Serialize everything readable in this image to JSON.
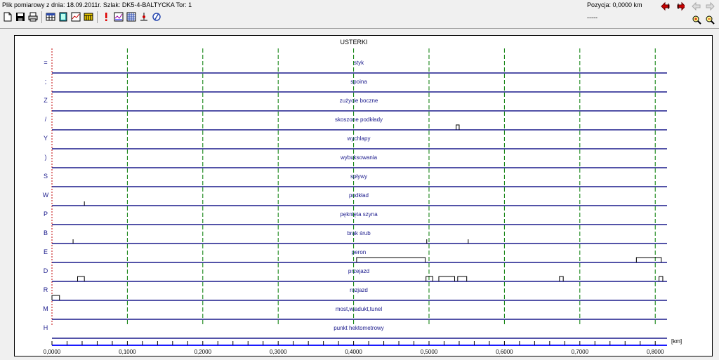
{
  "title_bar": {
    "text": "Plik pomiarowy z dnia: 18.09.2011r. Szlak: DK5-4-BALTYCKA Tor: 1"
  },
  "position": {
    "label": "Pozycja: 0,0000 km",
    "sub": "-----"
  },
  "toolbar": {
    "left_icons": [
      "new-file-icon",
      "save-icon",
      "print-icon",
      "table-icon",
      "notebook-icon",
      "chart-icon",
      "calendar-icon",
      "alert-icon",
      "graph-icon",
      "grid-icon",
      "measure-icon",
      "null-icon"
    ],
    "right_icons": [
      "move-left-icon",
      "move-right-icon",
      "back-arrow-icon",
      "forward-arrow-icon",
      "zoom-in-icon",
      "zoom-out-icon"
    ]
  },
  "chart_data": {
    "type": "step",
    "title": "USTERKI",
    "x_unit": "[km]",
    "xlim": [
      0,
      0.81
    ],
    "x_ticks": [
      "0,0000",
      "0,1000",
      "0,2000",
      "0,3000",
      "0,4000",
      "0,5000",
      "0,6000",
      "0,7000",
      "0,8000"
    ],
    "rows": [
      {
        "code": "=",
        "name": "styk",
        "segments": []
      },
      {
        "code": ";",
        "name": "spoina",
        "segments": []
      },
      {
        "code": "Z",
        "name": "zużycie boczne",
        "segments": []
      },
      {
        "code": "/",
        "name": "skoszone podkłady",
        "segments": [
          [
            0.536,
            0.54
          ]
        ]
      },
      {
        "code": "Y",
        "name": "wychlapy",
        "segments": []
      },
      {
        "code": ")",
        "name": "wybuksowania",
        "segments": []
      },
      {
        "code": "S",
        "name": "spływy",
        "segments": []
      },
      {
        "code": "W",
        "name": "podkład",
        "segments": [],
        "marks": [
          0.043
        ]
      },
      {
        "code": "P",
        "name": "pęknięta szyna",
        "segments": []
      },
      {
        "code": "B",
        "name": "brak śrub",
        "segments": [],
        "marks": [
          0.028,
          0.497,
          0.552
        ]
      },
      {
        "code": "E",
        "name": "peron",
        "segments": [
          [
            0.404,
            0.495
          ],
          [
            0.775,
            0.808
          ]
        ]
      },
      {
        "code": "D",
        "name": "przejazd",
        "segments": [
          [
            0.034,
            0.043
          ],
          [
            0.496,
            0.505
          ],
          [
            0.513,
            0.534
          ],
          [
            0.538,
            0.55
          ],
          [
            0.673,
            0.678
          ],
          [
            0.805,
            0.81
          ]
        ]
      },
      {
        "code": "R",
        "name": "rozjazd",
        "segments": [
          [
            0.0,
            0.01
          ]
        ]
      },
      {
        "code": "M",
        "name": "most,wiadukt,tunel",
        "segments": []
      },
      {
        "code": "H",
        "name": "punkt hektometrowy",
        "segments": []
      }
    ],
    "colors": {
      "baseline": "#1a1a8c",
      "grid": "#007a00",
      "label": "#1a1a8c",
      "step": "#000000",
      "marker": "#c00000",
      "axis": "#1a1aff"
    }
  }
}
